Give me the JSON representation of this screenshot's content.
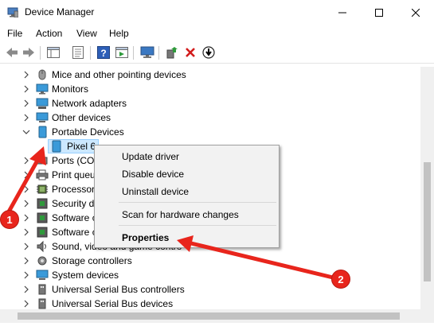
{
  "window": {
    "title": "Device Manager",
    "app_icon": "device-manager-icon",
    "controls": [
      "minimize-icon",
      "maximize-icon",
      "close-icon"
    ]
  },
  "menubar": {
    "items": [
      {
        "label": "File"
      },
      {
        "label": "Action"
      },
      {
        "label": "View"
      },
      {
        "label": "Help"
      }
    ]
  },
  "toolbar": {
    "buttons": [
      "back-arrow-icon",
      "forward-arrow-icon",
      "show-hide-tree-icon",
      "properties-sheet-icon",
      "help-icon",
      "run-icon",
      "monitor-scan-icon",
      "update-driver-icon",
      "uninstall-x-icon",
      "download-circle-icon"
    ]
  },
  "tree": {
    "items": [
      {
        "label": "Mice and other pointing devices",
        "icon": "mouse-icon",
        "expanded": false,
        "level": 0
      },
      {
        "label": "Monitors",
        "icon": "monitor-icon",
        "expanded": false,
        "level": 0
      },
      {
        "label": "Network adapters",
        "icon": "network-adapter-icon",
        "expanded": false,
        "level": 0
      },
      {
        "label": "Other devices",
        "icon": "other-device-icon",
        "expanded": false,
        "level": 0
      },
      {
        "label": "Portable Devices",
        "icon": "portable-device-icon",
        "expanded": true,
        "level": 0
      },
      {
        "label": "Pixel 6",
        "icon": "phone-icon",
        "level": 1,
        "selected": true
      },
      {
        "label": "Ports (COM",
        "icon": "port-icon",
        "expanded": false,
        "level": 0
      },
      {
        "label": "Print queu",
        "icon": "printer-icon",
        "expanded": false,
        "level": 0
      },
      {
        "label": "Processors",
        "icon": "processor-icon",
        "expanded": false,
        "level": 0
      },
      {
        "label": "Security d",
        "icon": "security-icon",
        "expanded": false,
        "level": 0
      },
      {
        "label": "Software c",
        "icon": "software-icon",
        "expanded": false,
        "level": 0
      },
      {
        "label": "Software c",
        "icon": "software-icon",
        "expanded": false,
        "level": 0
      },
      {
        "label": "Sound, video and game contro",
        "icon": "sound-icon",
        "expanded": false,
        "level": 0
      },
      {
        "label": "Storage controllers",
        "icon": "storage-icon",
        "expanded": false,
        "level": 0
      },
      {
        "label": "System devices",
        "icon": "system-device-icon",
        "expanded": false,
        "level": 0
      },
      {
        "label": "Universal Serial Bus controllers",
        "icon": "usb-icon",
        "expanded": false,
        "level": 0
      },
      {
        "label": "Universal Serial Bus devices",
        "icon": "usb-icon",
        "expanded": false,
        "level": 0
      }
    ]
  },
  "context_menu": {
    "items": [
      {
        "label": "Update driver"
      },
      {
        "label": "Disable device"
      },
      {
        "label": "Uninstall device"
      },
      {
        "label": "Scan for hardware changes"
      },
      {
        "label": "Properties",
        "bold": true
      }
    ]
  },
  "annotations": {
    "badge_1": "1",
    "badge_2": "2",
    "accent_color": "#e8251c"
  },
  "colors": {
    "selection": "#cce8ff",
    "menu_background": "#f2f2f2"
  }
}
